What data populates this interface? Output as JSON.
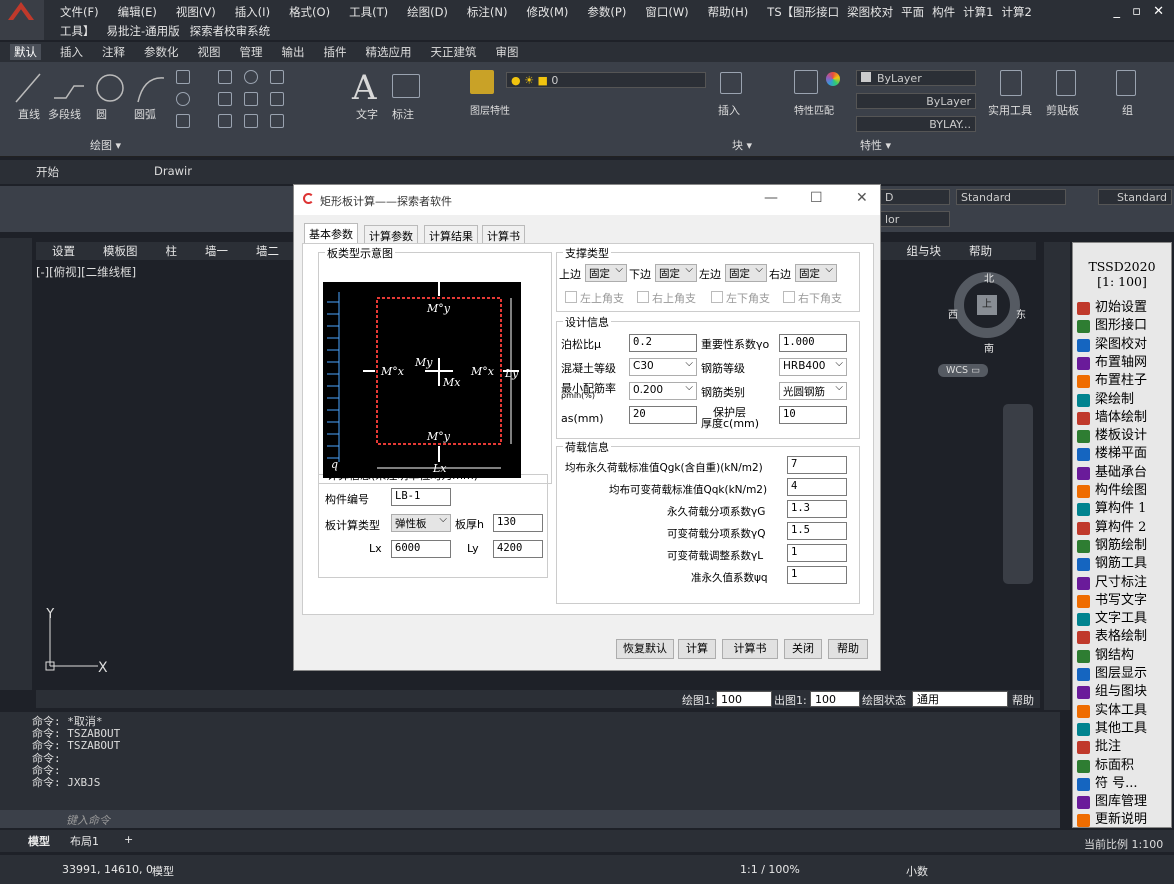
{
  "menubar": {
    "row1": [
      "文件(F)",
      "编辑(E)",
      "视图(V)",
      "插入(I)",
      "格式(O)",
      "工具(T)",
      "绘图(D)",
      "标注(N)",
      "修改(M)",
      "参数(P)",
      "窗口(W)",
      "帮助(H)",
      "TS【图形接口",
      "梁图校对",
      "平面",
      "构件",
      "计算1",
      "计算2"
    ],
    "row2": [
      "工具】",
      "易批注-通用版",
      "探索者校审系统"
    ],
    "window_controls": "_ ▫ ✕"
  },
  "ribbon_tabs": [
    "默认",
    "插入",
    "注释",
    "参数化",
    "视图",
    "管理",
    "输出",
    "插件",
    "精选应用",
    "天正建筑",
    "审图"
  ],
  "ribbon": {
    "draw_label": "绘图 ▾",
    "line": "直线",
    "polyline": "多段线",
    "circle": "圆",
    "arc": "圆弧",
    "text": "文字",
    "dim": "标注",
    "layer": "图层特性",
    "insert": "插入",
    "match": "特性匹配",
    "bylayer1": "ByLayer",
    "bylayer2": "ByLayer",
    "bylayer3": "BYLAY...",
    "props_label": "特性 ▾",
    "util": "实用工具",
    "clip": "剪贴板",
    "group": "组",
    "layer_current": "0",
    "block_label": "块 ▾"
  },
  "quickbar": {
    "start": "开始",
    "drawing": "Drawir"
  },
  "styles": {
    "standard1": "Standard",
    "standard2": "Standard",
    "color": "lor",
    "d": "D"
  },
  "topmenu2": [
    "设置",
    "模板图",
    "柱",
    "墙一",
    "墙二",
    "层",
    "组与块",
    "帮助"
  ],
  "view_label": "[-][俯视][二维线框]",
  "compass": {
    "n": "北",
    "s": "南",
    "e": "东",
    "w": "西",
    "center": "上",
    "wcs": "WCS ▭"
  },
  "bottombar": {
    "plot_label": "绘图1:",
    "plot_val": "100",
    "out_label": "出图1:",
    "out_val": "100",
    "state_label": "绘图状态",
    "state_val": "通用",
    "help": "帮助"
  },
  "command_lines": [
    "命令: *取消*",
    "命令: TSZABOUT",
    "命令: TSZABOUT",
    "命令:",
    "命令:",
    "命令: JXBJS"
  ],
  "command_placeholder": "键入命令",
  "layout_tabs": [
    "模型",
    "布局1",
    "+"
  ],
  "statusbar": {
    "coords": "33991, 14610, 0",
    "model": "模型",
    "scale": "1:1 / 100%",
    "decimal": "小数",
    "current_scale": "当前比例 1:100"
  },
  "rightpanel": {
    "title": "TSSD2020",
    "scale": "[1: 100]",
    "items": [
      "初始设置",
      "图形接口",
      "梁图校对",
      "布置轴网",
      "布置柱子",
      "梁绘制",
      "墙体绘制",
      "楼板设计",
      "楼梯平面",
      "基础承台",
      "构件绘图",
      "算构件 1",
      "算构件 2",
      "钢筋绘制",
      "钢筋工具",
      "尺寸标注",
      "书写文字",
      "文字工具",
      "表格绘制",
      "钢结构",
      "图层显示",
      "组与图块",
      "实体工具",
      "其他工具",
      "批注",
      "标面积",
      "符 号...",
      "图库管理",
      "更新说明"
    ]
  },
  "dialog": {
    "title": "矩形板计算——探索者软件",
    "tabs": [
      "基本参数",
      "计算参数",
      "计算结果",
      "计算书"
    ],
    "diagram_title": "板类型示意图",
    "diagram_labels": {
      "mx": "Mx",
      "my": "My",
      "mx0": "M°x",
      "my0": "M°y",
      "lx": "Lx",
      "ly": "Ly",
      "q": "q"
    },
    "support": {
      "title": "支撑类型",
      "top_label": "上边",
      "top_val": "固定",
      "bottom_label": "下边",
      "bottom_val": "固定",
      "left_label": "左边",
      "left_val": "固定",
      "right_label": "右边",
      "right_val": "固定",
      "corners": [
        "左上角支",
        "右上角支",
        "左下角支",
        "右下角支"
      ]
    },
    "design": {
      "title": "设计信息",
      "poisson_label": "泊松比μ",
      "poisson": "0.2",
      "importance_label": "重要性系数γo",
      "importance": "1.000",
      "concrete_label": "混凝土等级",
      "concrete": "C30",
      "rebar_label": "钢筋等级",
      "rebar": "HRB400",
      "rhomin_label": "最小配筋率",
      "rhomin_sub": "ρmin(%)",
      "rhomin": "0.200",
      "rebartype_label": "钢筋类别",
      "rebartype": "光圆钢筋",
      "as_label": "as(mm)",
      "as": "20",
      "cover_label1": "保护层",
      "cover_label2": "厚度c(mm)",
      "cover": "10"
    },
    "calc_info": {
      "title": "计算信息(未注明单位均为mm)",
      "id_label": "构件编号",
      "id": "LB-1",
      "type_label": "板计算类型",
      "type": "弹性板",
      "thick_label": "板厚h",
      "thick": "130",
      "lx_label": "Lx",
      "lx": "6000",
      "ly_label": "Ly",
      "ly": "4200"
    },
    "loads": {
      "title": "荷载信息",
      "rows": [
        {
          "label": "均布永久荷载标准值Qgk(含自重)(kN/m2)",
          "value": "7"
        },
        {
          "label": "均布可变荷载标准值Qqk(kN/m2)",
          "value": "4"
        },
        {
          "label": "永久荷载分项系数γG",
          "value": "1.3"
        },
        {
          "label": "可变荷载分项系数γQ",
          "value": "1.5"
        },
        {
          "label": "可变荷载调整系数γL",
          "value": "1"
        },
        {
          "label": "准永久值系数ψq",
          "value": "1"
        }
      ]
    },
    "buttons": [
      "恢复默认",
      "计算",
      "计算书",
      "关闭",
      "帮助"
    ]
  }
}
